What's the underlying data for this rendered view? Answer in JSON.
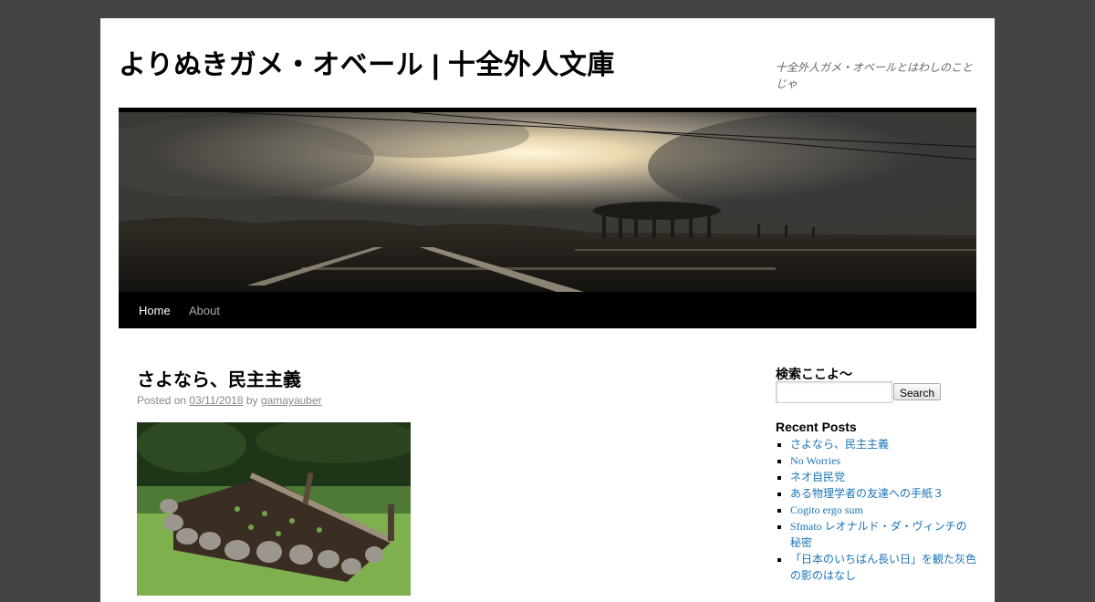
{
  "site": {
    "title": "よりぬきガメ・オベール | 十全外人文庫",
    "description": "十全外人ガメ・オベールとはわしのことじゃ"
  },
  "menu": {
    "items": [
      {
        "label": "Home",
        "current": true
      },
      {
        "label": "About",
        "current": false
      }
    ]
  },
  "post": {
    "title": "さよなら、民主主義",
    "posted_on_label": "Posted on",
    "date": "03/11/2018",
    "by_label": "by",
    "author": "gamayauber"
  },
  "sidebar": {
    "search_title": "検索ここよ〜",
    "search_input_value": "",
    "search_button_label": "Search",
    "recent_title": "Recent Posts",
    "recent_posts": [
      "さよなら、民主主義",
      "No Worries",
      "ネオ自民党",
      "ある物理学者の友達への手紙３",
      "Cogito ergo sum",
      "Sfmato レオナルド・ダ・ヴィンチの秘密",
      "「日本のいちばん長い日」を観た灰色の影のはなし"
    ]
  },
  "colors": {
    "page_background": "#444444",
    "nav_background": "#000000",
    "link": "#1a74b6"
  }
}
